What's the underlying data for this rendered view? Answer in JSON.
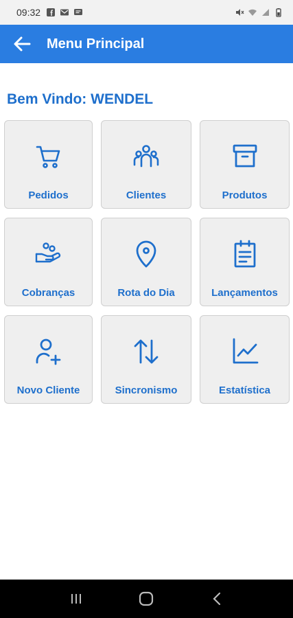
{
  "status_bar": {
    "time": "09:32",
    "left_icons": [
      "facebook-icon",
      "gmail-icon",
      "message-icon"
    ],
    "right_icons": [
      "mute-icon",
      "wifi-icon",
      "signal-icon",
      "battery-icon"
    ]
  },
  "app_bar": {
    "title": "Menu Principal",
    "back_icon": "arrow-left-icon",
    "color": "#2a7de1"
  },
  "welcome": "Bem Vindo: WENDEL",
  "accent_color": "#1e6fcc",
  "menu": [
    {
      "label": "Pedidos",
      "icon": "cart-icon"
    },
    {
      "label": "Clientes",
      "icon": "users-icon"
    },
    {
      "label": "Produtos",
      "icon": "archive-icon"
    },
    {
      "label": "Cobranças",
      "icon": "hand-coins-icon"
    },
    {
      "label": "Rota do Dia",
      "icon": "map-pin-icon"
    },
    {
      "label": "Lançamentos",
      "icon": "clipboard-icon"
    },
    {
      "label": "Novo Cliente",
      "icon": "user-plus-icon"
    },
    {
      "label": "Sincronismo",
      "icon": "sync-arrows-icon"
    },
    {
      "label": "Estatística",
      "icon": "trend-chart-icon"
    }
  ],
  "nav_bar": {
    "buttons": [
      "recents-icon",
      "home-icon",
      "back-icon"
    ]
  }
}
